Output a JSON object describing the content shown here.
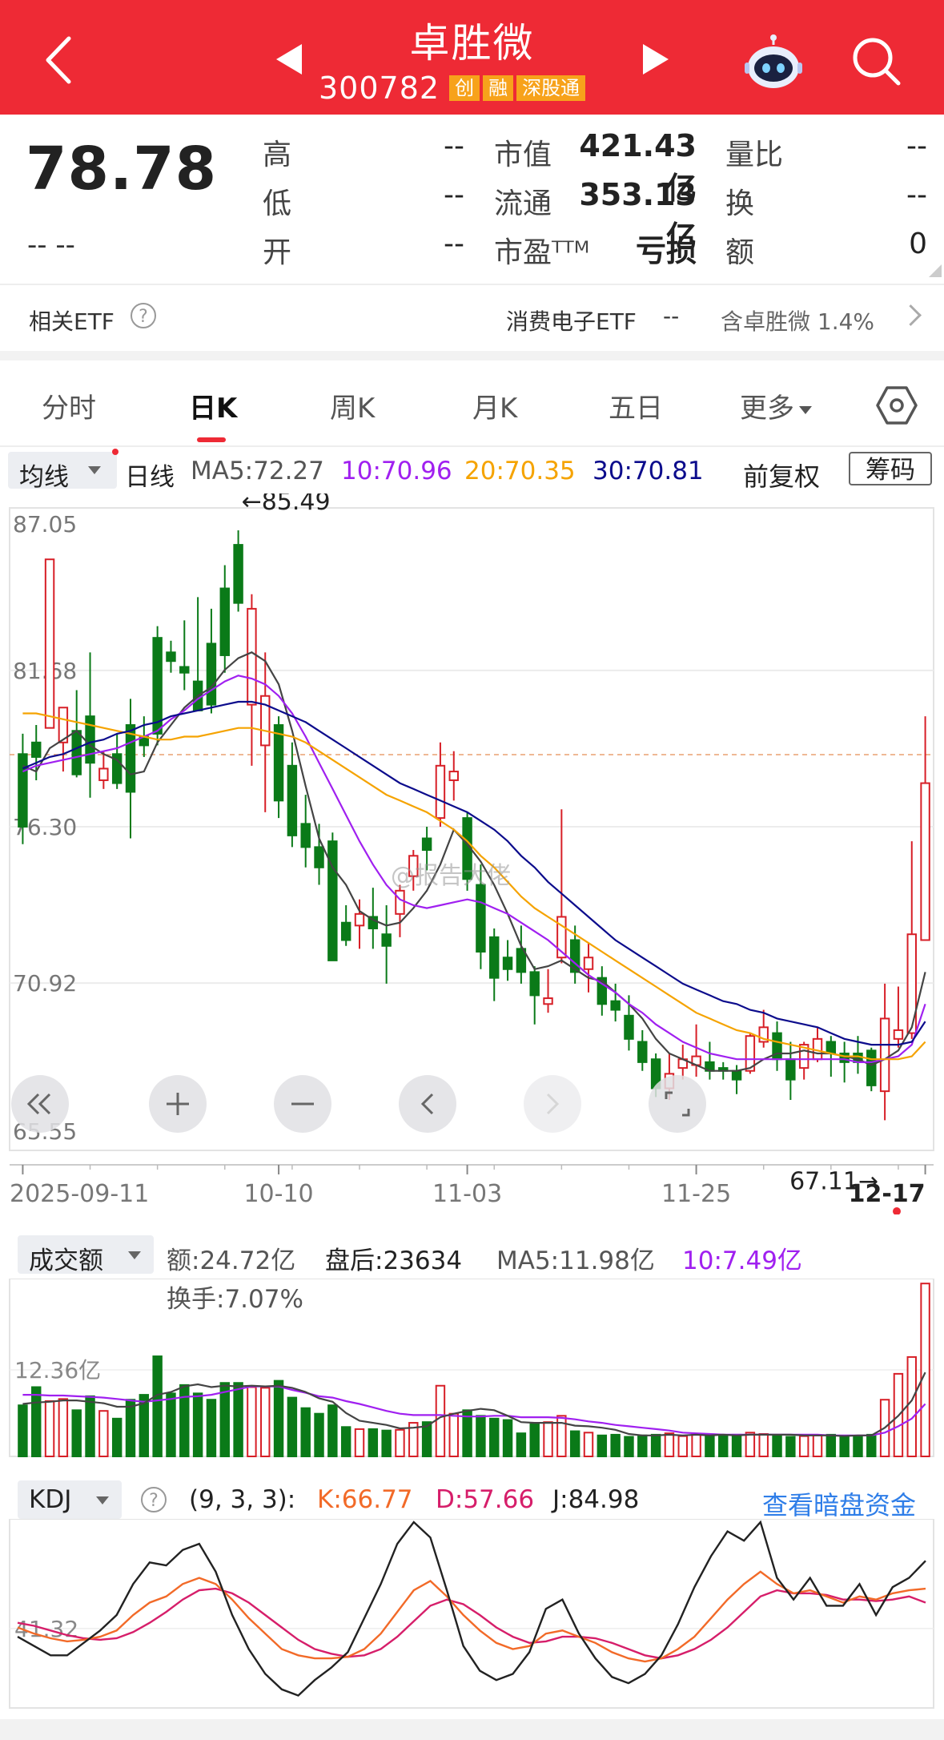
{
  "header": {
    "title": "卓胜微",
    "code": "300782",
    "tags": [
      "创",
      "融",
      "深股通"
    ]
  },
  "quote": {
    "price": "78.78",
    "change": "-- --",
    "high_label": "高",
    "high": "--",
    "low_label": "低",
    "low": "--",
    "open_label": "开",
    "open": "--",
    "mcap_label": "市值",
    "mcap": "421.43亿",
    "float_label": "流通",
    "float": "353.13亿",
    "pe_label": "市盈ᵀᵀᴹ",
    "pe": "亏损",
    "vr_label": "量比",
    "vr": "--",
    "turnover_label": "换",
    "turnover": "--",
    "amount_label": "额",
    "amount": "0"
  },
  "etf": {
    "label": "相关ETF",
    "help": "?",
    "name": "消费电子ETF",
    "change": "--",
    "holding": "含卓胜微 1.4%"
  },
  "tabs": [
    "分时",
    "日K",
    "周K",
    "月K",
    "五日",
    "更多"
  ],
  "active_tab": "日K",
  "ma_bar": {
    "dropdown": "均线",
    "period": "日线",
    "ma5": "MA5:72.27",
    "ma10": "10:70.96",
    "ma20": "20:70.35",
    "ma30": "30:70.81",
    "adjust": "前复权",
    "chips": "筹码"
  },
  "colors": {
    "up": "#d71f27",
    "down": "#0a7a18",
    "ma5": "#444444",
    "ma10": "#a020f0",
    "ma20": "#f5a300",
    "ma30": "#0c0c8c",
    "brand": "#ee2a35"
  },
  "watermark": "@报告大佬",
  "chart_data": [
    {
      "type": "candlestick",
      "y_ticks": [
        "87.05",
        "81.68",
        "76.30",
        "70.92",
        "65.55"
      ],
      "ylim": [
        65.55,
        87.05
      ],
      "x_ticks": [
        "2025-09-11",
        "10-10",
        "11-03",
        "11-25",
        "12-17"
      ],
      "max_label": "←85.49",
      "min_label": "67.11→",
      "reference_price": 78.78,
      "candles": [
        [
          78.8,
          76.3,
          79.5,
          75.7
        ],
        [
          79.2,
          78.7,
          79.8,
          77.9
        ],
        [
          79.7,
          85.5,
          85.5,
          79.7
        ],
        [
          79.2,
          80.4,
          79.9,
          78.2
        ],
        [
          79.6,
          78.1,
          81.0,
          78.0
        ],
        [
          80.1,
          78.5,
          82.3,
          77.3
        ],
        [
          77.9,
          78.3,
          78.9,
          77.6
        ],
        [
          78.8,
          77.8,
          79.5,
          77.6
        ],
        [
          79.8,
          77.5,
          80.7,
          75.9
        ],
        [
          79.4,
          79.1,
          80.1,
          78.7
        ],
        [
          82.8,
          79.5,
          83.2,
          79.1
        ],
        [
          82.3,
          82.0,
          82.7,
          81.6
        ],
        [
          81.8,
          81.6,
          83.4,
          81.0
        ],
        [
          81.3,
          80.3,
          84.2,
          80.3
        ],
        [
          82.6,
          80.5,
          83.8,
          80.2
        ],
        [
          84.5,
          82.2,
          85.3,
          81.6
        ],
        [
          86.0,
          84.0,
          86.5,
          83.7
        ],
        [
          80.5,
          83.8,
          84.3,
          78.4
        ],
        [
          79.1,
          80.8,
          82.3,
          76.8
        ],
        [
          79.8,
          77.2,
          80.1,
          76.6
        ],
        [
          78.4,
          76.0,
          79.2,
          75.6
        ],
        [
          76.4,
          75.6,
          77.4,
          74.9
        ],
        [
          75.6,
          74.9,
          76.4,
          74.3
        ],
        [
          75.8,
          71.7,
          76.1,
          71.7
        ],
        [
          73.0,
          72.4,
          73.6,
          72.2
        ],
        [
          72.9,
          73.3,
          73.8,
          72.1
        ],
        [
          73.2,
          72.8,
          74.2,
          72.1
        ],
        [
          72.6,
          72.2,
          73.6,
          70.9
        ],
        [
          73.3,
          74.1,
          74.3,
          72.5
        ],
        [
          74.6,
          75.3,
          75.5,
          74.1
        ],
        [
          75.9,
          75.5,
          76.3,
          74.8
        ],
        [
          76.6,
          78.4,
          79.2,
          76.3
        ],
        [
          77.9,
          78.2,
          78.9,
          77.2
        ],
        [
          76.6,
          74.5,
          76.8,
          74.1
        ],
        [
          74.3,
          72.0,
          75.0,
          71.4
        ],
        [
          72.5,
          71.1,
          72.8,
          70.3
        ],
        [
          71.8,
          71.4,
          72.4,
          71.0
        ],
        [
          72.1,
          71.3,
          72.9,
          70.9
        ],
        [
          71.3,
          70.5,
          71.5,
          69.5
        ],
        [
          70.2,
          70.4,
          71.4,
          69.9
        ],
        [
          71.8,
          73.2,
          76.9,
          71.6
        ],
        [
          72.4,
          71.3,
          72.9,
          70.9
        ],
        [
          71.4,
          71.8,
          72.3,
          70.6
        ],
        [
          71.1,
          70.2,
          71.5,
          69.8
        ],
        [
          70.3,
          70.0,
          70.9,
          69.6
        ],
        [
          69.8,
          69.0,
          70.5,
          68.6
        ],
        [
          68.9,
          68.2,
          69.3,
          67.9
        ],
        [
          68.3,
          67.3,
          68.5,
          67.0
        ],
        [
          67.3,
          67.8,
          68.5,
          66.9
        ],
        [
          68.0,
          68.3,
          68.8,
          67.6
        ],
        [
          68.1,
          68.4,
          69.5,
          67.7
        ],
        [
          68.2,
          67.9,
          68.9,
          67.6
        ],
        [
          68.0,
          67.9,
          68.2,
          67.6
        ],
        [
          67.9,
          67.6,
          68.1,
          67.1
        ],
        [
          67.9,
          69.1,
          69.2,
          67.8
        ],
        [
          68.9,
          69.4,
          70.0,
          68.7
        ],
        [
          69.2,
          68.3,
          69.6,
          67.9
        ],
        [
          68.3,
          67.6,
          68.9,
          66.9
        ],
        [
          68.0,
          68.8,
          68.9,
          67.6
        ],
        [
          68.3,
          69.0,
          69.4,
          68.2
        ],
        [
          68.9,
          68.5,
          69.1,
          67.7
        ],
        [
          68.5,
          68.2,
          68.9,
          67.5
        ],
        [
          68.5,
          68.2,
          69.1,
          67.8
        ],
        [
          68.6,
          67.4,
          68.7,
          67.2
        ],
        [
          67.2,
          69.7,
          70.9,
          66.2
        ],
        [
          69.0,
          69.3,
          70.8,
          68.7
        ],
        [
          69.2,
          72.6,
          75.8,
          69.0
        ],
        [
          72.4,
          77.8,
          80.1,
          72.4
        ]
      ],
      "ma_lines": {
        "ma5": [
          78.4,
          78.2,
          79.0,
          79.3,
          79.6,
          79.1,
          78.8,
          78.6,
          78.1,
          78.2,
          79.2,
          79.8,
          80.4,
          80.8,
          81.1,
          81.7,
          82.1,
          82.3,
          82.0,
          81.2,
          79.6,
          77.7,
          75.9,
          74.9,
          74.3,
          73.4,
          73.1,
          72.9,
          73.0,
          73.5,
          74.1,
          75.0,
          76.2,
          75.7,
          75.1,
          74.3,
          73.3,
          72.2,
          71.4,
          71.5,
          71.7,
          71.4,
          71.1,
          71.0,
          70.6,
          70.2,
          69.7,
          69.0,
          68.5,
          68.3,
          68.1,
          67.9,
          67.9,
          67.9,
          68.0,
          68.3,
          68.5,
          68.5,
          68.6,
          68.5,
          68.5,
          68.4,
          68.3,
          68.1,
          68.3,
          68.6,
          69.4,
          71.3
        ],
        "ma10": [
          78.2,
          78.4,
          78.5,
          78.6,
          78.7,
          78.8,
          78.9,
          79.0,
          79.2,
          79.4,
          79.6,
          80.0,
          80.3,
          80.7,
          81.0,
          81.3,
          81.5,
          81.4,
          81.2,
          80.8,
          80.2,
          79.4,
          78.5,
          77.6,
          76.7,
          75.8,
          75.0,
          74.3,
          73.8,
          73.6,
          73.5,
          73.6,
          73.7,
          73.8,
          73.7,
          73.5,
          73.3,
          73.0,
          72.7,
          72.4,
          72.0,
          71.6,
          71.2,
          70.9,
          70.6,
          70.2,
          69.9,
          69.5,
          69.2,
          68.9,
          68.7,
          68.5,
          68.4,
          68.3,
          68.3,
          68.3,
          68.3,
          68.3,
          68.3,
          68.3,
          68.3,
          68.3,
          68.2,
          68.2,
          68.3,
          68.4,
          68.8,
          70.2
        ],
        "ma20": [
          80.2,
          80.2,
          80.1,
          80.0,
          79.9,
          79.8,
          79.7,
          79.6,
          79.5,
          79.4,
          79.3,
          79.3,
          79.4,
          79.4,
          79.5,
          79.6,
          79.7,
          79.7,
          79.6,
          79.5,
          79.4,
          79.2,
          78.9,
          78.6,
          78.3,
          78.0,
          77.7,
          77.4,
          77.2,
          77.0,
          76.8,
          76.5,
          76.2,
          75.8,
          75.3,
          74.9,
          74.4,
          73.9,
          73.5,
          73.2,
          72.9,
          72.6,
          72.3,
          72.0,
          71.7,
          71.4,
          71.1,
          70.8,
          70.5,
          70.2,
          69.9,
          69.7,
          69.5,
          69.3,
          69.2,
          69.0,
          68.9,
          68.8,
          68.7,
          68.6,
          68.5,
          68.4,
          68.4,
          68.3,
          68.3,
          68.3,
          68.4,
          68.9
        ],
        "ma30": [
          78.3,
          78.5,
          78.7,
          78.8,
          79.0,
          79.2,
          79.3,
          79.5,
          79.6,
          79.8,
          79.9,
          80.1,
          80.2,
          80.3,
          80.4,
          80.5,
          80.6,
          80.6,
          80.5,
          80.3,
          80.1,
          79.9,
          79.6,
          79.3,
          79.0,
          78.7,
          78.4,
          78.1,
          77.8,
          77.6,
          77.4,
          77.2,
          77.0,
          76.8,
          76.5,
          76.2,
          75.8,
          75.3,
          74.9,
          74.4,
          74.0,
          73.6,
          73.2,
          72.8,
          72.4,
          72.1,
          71.8,
          71.5,
          71.2,
          70.9,
          70.7,
          70.5,
          70.3,
          70.2,
          70.0,
          69.9,
          69.7,
          69.6,
          69.5,
          69.4,
          69.2,
          69.0,
          68.9,
          68.8,
          68.8,
          68.8,
          68.9,
          69.6
        ]
      }
    },
    {
      "type": "bar",
      "title": "成交额",
      "amount_text": "额:24.72亿",
      "after_hours_text": "盘后:23634",
      "ma5_text": "MA5:11.98亿",
      "ma10_text": "10:7.49亿",
      "turnover_text": "换手:7.07%",
      "y_tick": "12.36亿",
      "ymax": 24.72,
      "values": [
        7.3,
        9.9,
        7.9,
        8.2,
        6.6,
        8.6,
        6.5,
        5.4,
        8.1,
        8.8,
        14.3,
        9.0,
        10.2,
        9.0,
        8.1,
        10.5,
        10.5,
        9.9,
        9.8,
        10.8,
        8.4,
        6.9,
        6.1,
        7.3,
        4.2,
        3.9,
        3.9,
        3.7,
        3.8,
        4.8,
        4.9,
        10.1,
        6.1,
        6.6,
        5.8,
        5.4,
        5.2,
        3.3,
        4.6,
        4.9,
        5.8,
        3.6,
        3.4,
        3.0,
        3.1,
        2.8,
        3.0,
        3.1,
        3.3,
        2.9,
        3.2,
        2.9,
        3.0,
        3.1,
        3.4,
        3.2,
        3.0,
        2.8,
        2.9,
        3.0,
        3.1,
        2.9,
        2.9,
        3.1,
        8.1,
        11.8,
        14.2,
        24.7
      ],
      "ma5": [
        7.5,
        7.7,
        7.8,
        8.0,
        8.0,
        7.8,
        7.6,
        7.1,
        7.1,
        7.6,
        8.8,
        9.2,
        10.0,
        10.3,
        9.9,
        10.1,
        10.0,
        10.1,
        10.0,
        10.1,
        9.8,
        9.2,
        8.3,
        7.8,
        6.2,
        5.1,
        4.8,
        4.5,
        4.0,
        4.1,
        4.3,
        5.6,
        6.1,
        6.5,
        6.8,
        6.6,
        5.8,
        4.9,
        4.8,
        4.8,
        4.8,
        4.4,
        4.3,
        4.1,
        3.8,
        3.2,
        3.0,
        3.0,
        3.1,
        3.0,
        3.1,
        3.0,
        3.1,
        3.0,
        3.1,
        3.1,
        3.1,
        3.1,
        3.0,
        3.0,
        3.0,
        2.9,
        3.0,
        3.0,
        4.1,
        5.8,
        8.0,
        12.0
      ],
      "ma10": [
        8.8,
        8.8,
        8.7,
        8.7,
        8.6,
        8.5,
        8.4,
        8.2,
        8.0,
        7.8,
        8.0,
        8.2,
        8.5,
        8.6,
        8.8,
        9.2,
        9.6,
        10.0,
        10.0,
        10.0,
        9.5,
        9.1,
        8.6,
        8.4,
        7.9,
        7.5,
        7.0,
        6.5,
        6.1,
        5.9,
        5.9,
        5.9,
        5.8,
        5.7,
        5.7,
        5.8,
        5.8,
        5.6,
        5.6,
        5.6,
        5.5,
        5.3,
        5.0,
        4.8,
        4.5,
        4.3,
        4.1,
        3.9,
        3.7,
        3.4,
        3.3,
        3.2,
        3.1,
        3.1,
        3.1,
        3.1,
        3.1,
        3.1,
        3.1,
        3.1,
        3.0,
        3.0,
        3.0,
        3.0,
        3.4,
        4.3,
        5.4,
        7.5
      ]
    },
    {
      "type": "line",
      "title": "KDJ",
      "params": "(9, 3, 3):",
      "k_text": "K:66.77",
      "d_text": "D:57.66",
      "j_text": "J:84.98",
      "y_tick": "41.32",
      "ylim": [
        -10,
        110
      ],
      "link": "查看暗盘资金",
      "K": [
        42,
        38,
        35,
        33,
        34,
        36,
        40,
        50,
        58,
        62,
        70,
        74,
        70,
        60,
        48,
        38,
        28,
        24,
        22,
        22,
        23,
        28,
        38,
        52,
        66,
        72,
        62,
        50,
        40,
        32,
        28,
        30,
        38,
        40,
        36,
        32,
        26,
        22,
        20,
        22,
        28,
        36,
        48,
        60,
        70,
        78,
        70,
        64,
        66,
        62,
        58,
        62,
        60,
        64,
        66,
        67
      ],
      "D": [
        45,
        43,
        40,
        37,
        35,
        34,
        35,
        39,
        45,
        52,
        60,
        66,
        67,
        64,
        58,
        50,
        42,
        34,
        28,
        25,
        23,
        24,
        28,
        36,
        46,
        56,
        60,
        57,
        50,
        42,
        36,
        32,
        33,
        36,
        36,
        35,
        32,
        28,
        24,
        22,
        24,
        28,
        34,
        42,
        52,
        62,
        66,
        64,
        64,
        63,
        60,
        60,
        59,
        60,
        62,
        58
      ],
      "J": [
        36,
        30,
        24,
        24,
        32,
        40,
        50,
        70,
        84,
        82,
        92,
        96,
        78,
        50,
        28,
        12,
        2,
        -2,
        8,
        16,
        26,
        48,
        70,
        96,
        110,
        100,
        66,
        30,
        14,
        8,
        12,
        26,
        54,
        60,
        38,
        22,
        10,
        6,
        12,
        24,
        44,
        68,
        88,
        104,
        98,
        110,
        74,
        60,
        74,
        56,
        56,
        70,
        50,
        68,
        74,
        85
      ]
    }
  ]
}
